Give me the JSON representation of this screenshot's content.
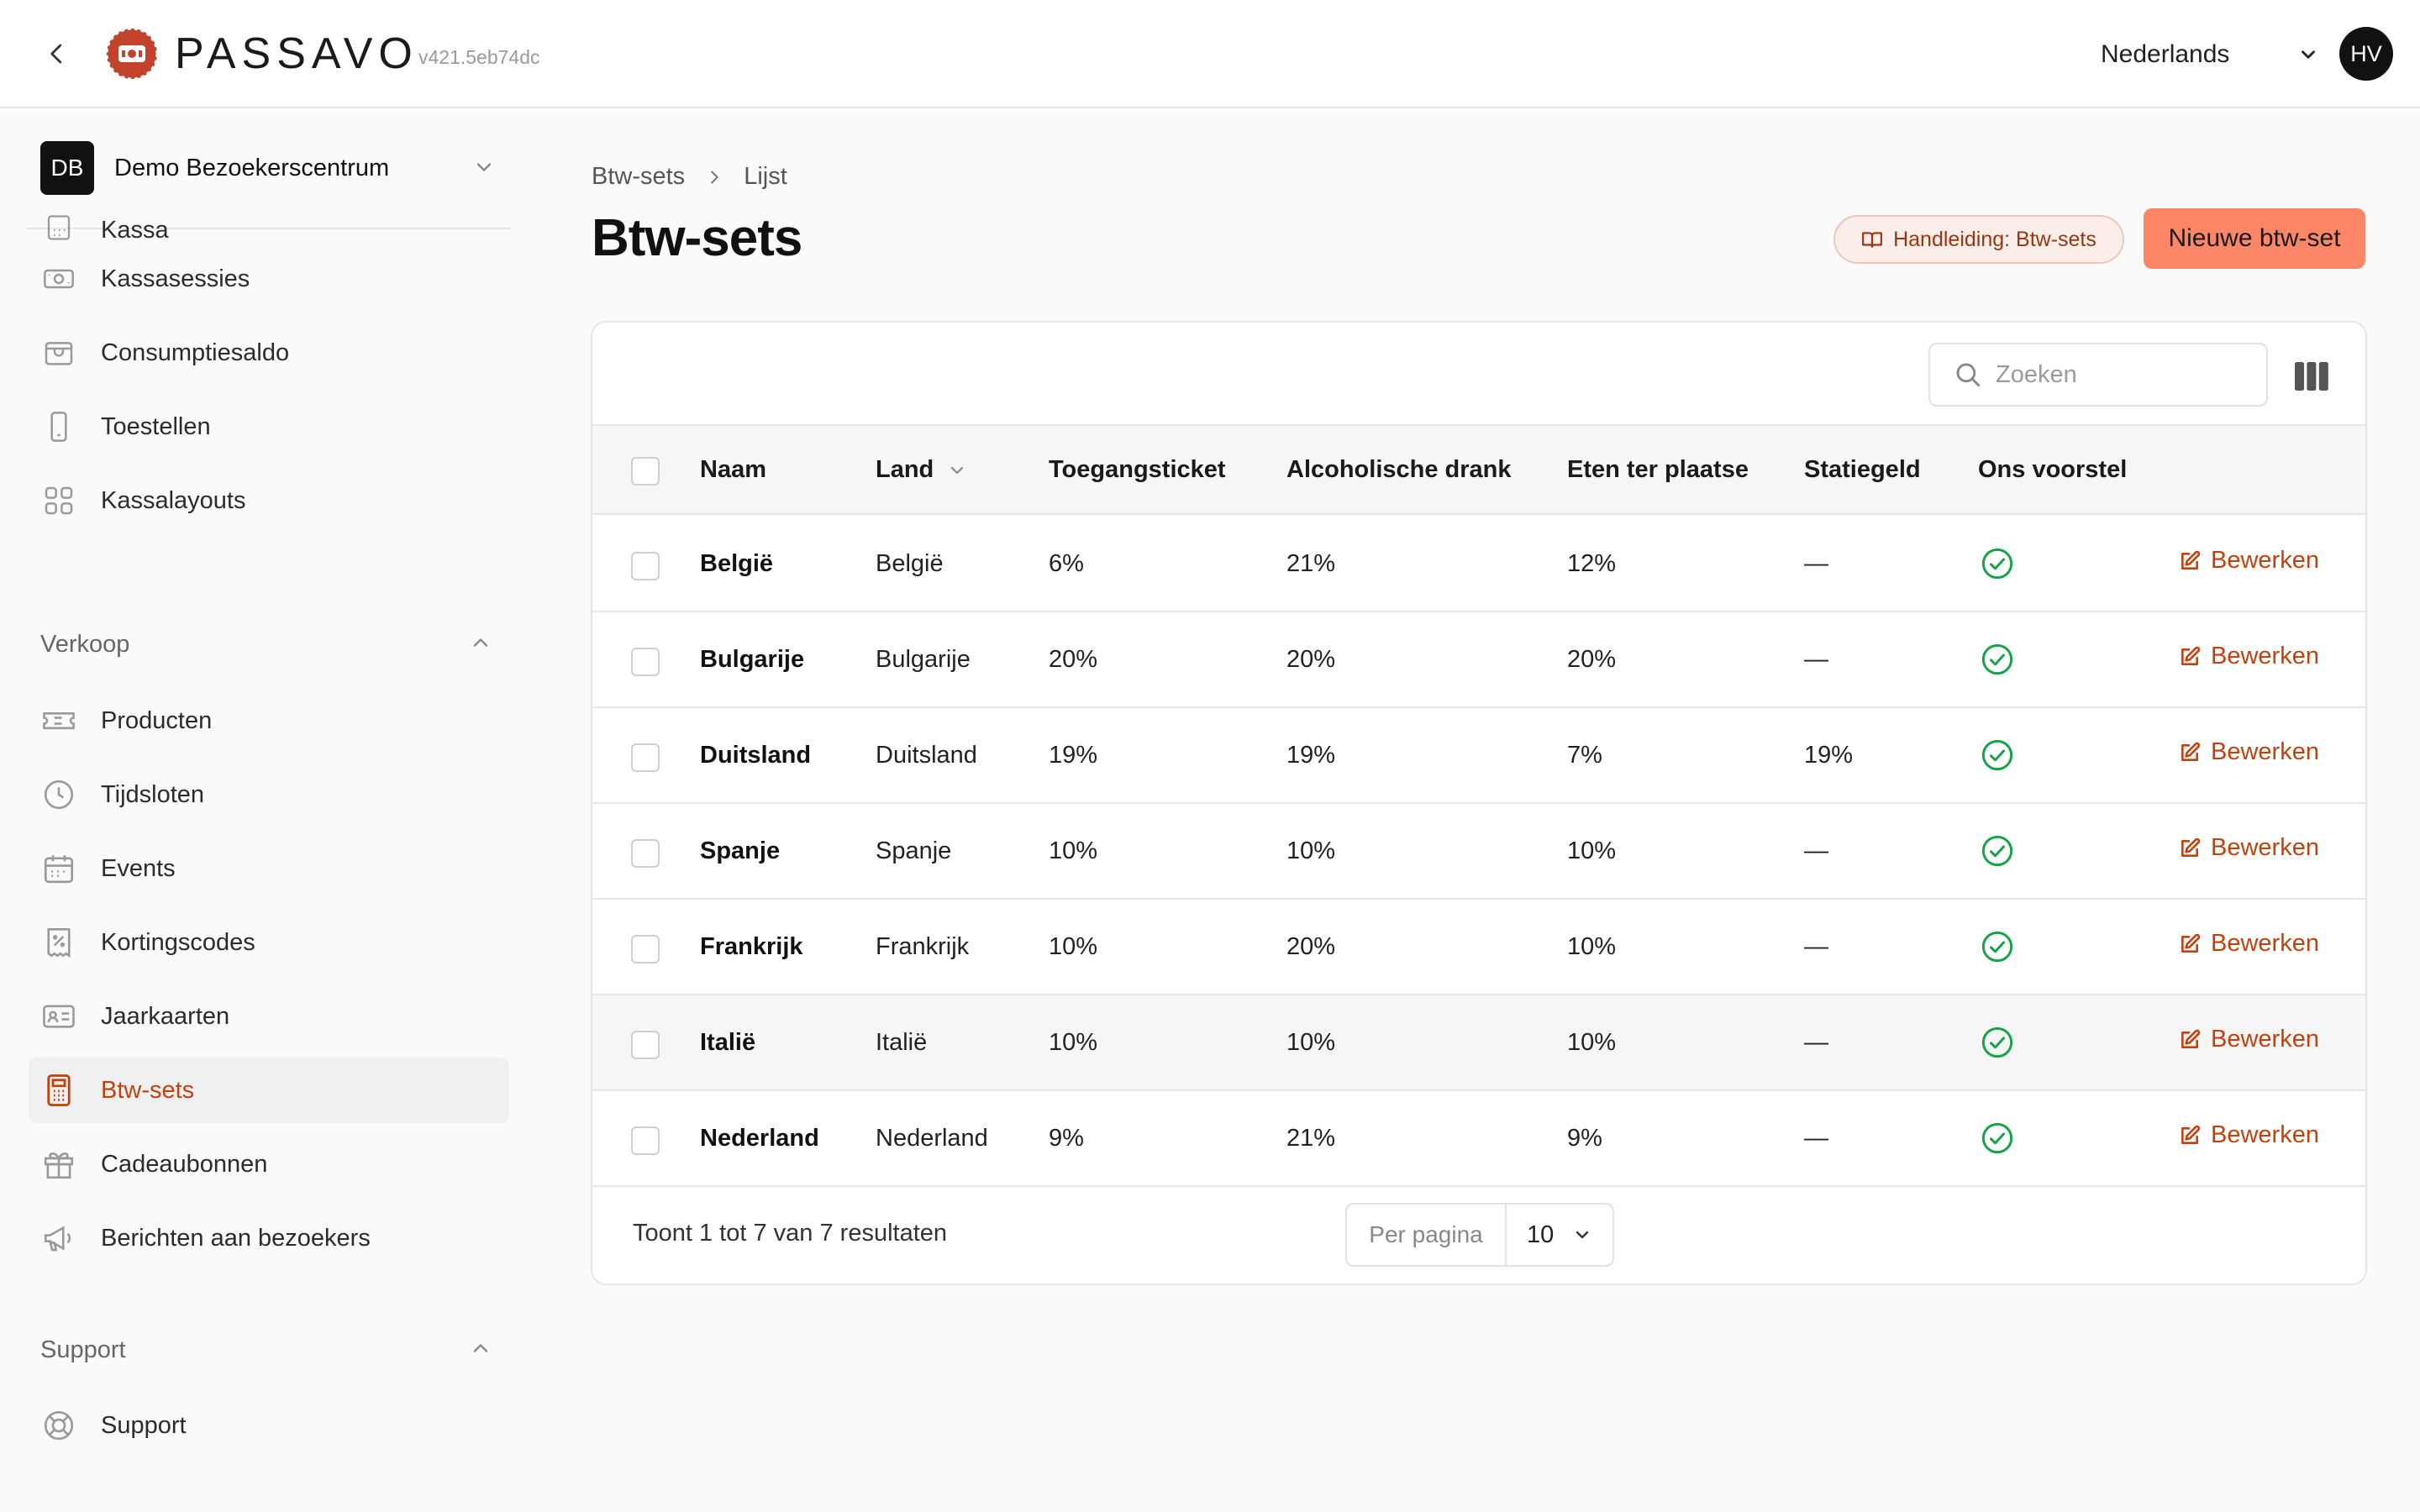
{
  "header": {
    "brand": "PASSAVO",
    "version": "v421.5eb74dc",
    "language": "Nederlands",
    "user_initials": "HV"
  },
  "sidebar": {
    "org": {
      "initials": "DB",
      "name": "Demo Bezoekerscentrum"
    },
    "top_items": [
      {
        "label": "Kassa",
        "icon": "register-icon"
      },
      {
        "label": "Kassasessies",
        "icon": "cash-icon"
      },
      {
        "label": "Consumptiesaldo",
        "icon": "wallet-icon"
      },
      {
        "label": "Toestellen",
        "icon": "phone-icon"
      },
      {
        "label": "Kassalayouts",
        "icon": "grid-icon"
      }
    ],
    "sections": [
      {
        "title": "Verkoop",
        "items": [
          {
            "label": "Producten",
            "icon": "ticket-icon"
          },
          {
            "label": "Tijdsloten",
            "icon": "clock-icon"
          },
          {
            "label": "Events",
            "icon": "calendar-icon"
          },
          {
            "label": "Kortingscodes",
            "icon": "discount-icon"
          },
          {
            "label": "Jaarkaarten",
            "icon": "id-card-icon"
          },
          {
            "label": "Btw-sets",
            "icon": "calculator-icon",
            "active": true
          },
          {
            "label": "Cadeaubonnen",
            "icon": "gift-icon"
          },
          {
            "label": "Berichten aan bezoekers",
            "icon": "megaphone-icon"
          }
        ]
      },
      {
        "title": "Support",
        "items": [
          {
            "label": "Support",
            "icon": "lifebuoy-icon"
          }
        ]
      }
    ]
  },
  "breadcrumb": {
    "parent": "Btw-sets",
    "current": "Lijst"
  },
  "page": {
    "title": "Btw-sets",
    "manual_label": "Handleiding: Btw-sets",
    "new_label": "Nieuwe btw-set",
    "search_placeholder": "Zoeken"
  },
  "table": {
    "columns": [
      "Naam",
      "Land",
      "Toegangsticket",
      "Alcoholische drank",
      "Eten ter plaatse",
      "Statiegeld",
      "Ons voorstel"
    ],
    "edit_label": "Bewerken",
    "rows": [
      {
        "naam": "België",
        "land": "België",
        "toegang": "6%",
        "alcohol": "21%",
        "eten": "12%",
        "statiegeld": "—",
        "voorstel": true
      },
      {
        "naam": "Bulgarije",
        "land": "Bulgarije",
        "toegang": "20%",
        "alcohol": "20%",
        "eten": "20%",
        "statiegeld": "—",
        "voorstel": true
      },
      {
        "naam": "Duitsland",
        "land": "Duitsland",
        "toegang": "19%",
        "alcohol": "19%",
        "eten": "7%",
        "statiegeld": "19%",
        "voorstel": true
      },
      {
        "naam": "Spanje",
        "land": "Spanje",
        "toegang": "10%",
        "alcohol": "10%",
        "eten": "10%",
        "statiegeld": "—",
        "voorstel": true
      },
      {
        "naam": "Frankrijk",
        "land": "Frankrijk",
        "toegang": "10%",
        "alcohol": "20%",
        "eten": "10%",
        "statiegeld": "—",
        "voorstel": true
      },
      {
        "naam": "Italië",
        "land": "Italië",
        "toegang": "10%",
        "alcohol": "10%",
        "eten": "10%",
        "statiegeld": "—",
        "voorstel": true
      },
      {
        "naam": "Nederland",
        "land": "Nederland",
        "toegang": "9%",
        "alcohol": "21%",
        "eten": "9%",
        "statiegeld": "—",
        "voorstel": true
      }
    ]
  },
  "footer": {
    "results_text": "Toont 1 tot 7 van 7 resultaten",
    "per_page_label": "Per pagina",
    "per_page_value": "10"
  },
  "colors": {
    "accent": "#c2410c",
    "primary_button": "#fb8668",
    "success": "#16a34a",
    "brand_logo": "#c0442b"
  }
}
